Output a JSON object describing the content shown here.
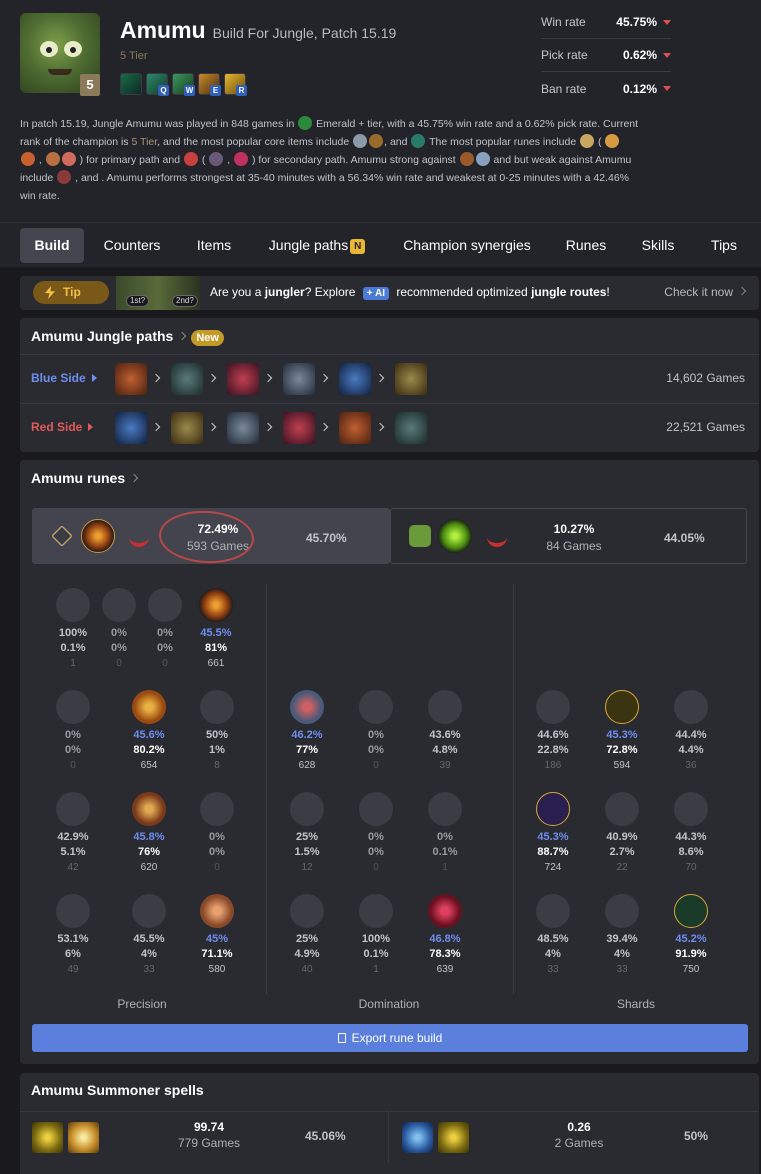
{
  "champion": {
    "name": "Amumu",
    "subtitle": "Build For Jungle, Patch 15.19",
    "tier_label": "5 Tier",
    "tier_badge": "5"
  },
  "skills": [
    {
      "key": ""
    },
    {
      "key": "Q"
    },
    {
      "key": "W"
    },
    {
      "key": "E"
    },
    {
      "key": "R"
    }
  ],
  "stats": [
    {
      "label": "Win rate",
      "value": "45.75%"
    },
    {
      "label": "Pick rate",
      "value": "0.62%"
    },
    {
      "label": "Ban rate",
      "value": "0.12%"
    }
  ],
  "description": {
    "l1a": "In patch 15.19, Jungle Amumu was played in 848 games in ",
    "l1b": " Emerald + tier, with a 45.75% win rate and a 0.62% pick rate. Current",
    "l2a": "rank of the champion is ",
    "l2tier": "5 Tier",
    "l2b": ", and the most popular core items include ",
    "l2c": ", and ",
    "l2d": " The most popular runes include ",
    "l2e": " ( ",
    "l3a": " , ",
    "l3b": " ) for primary path and ",
    "l3c": " ( ",
    "l3d": " , ",
    "l3e": " ) for secondary path. Amumu strong against ",
    "l3f": " and but weak against Amumu",
    "l4a": "include ",
    "l4b": " , and . Amumu performs strongest at 35-40 minutes with a 56.34% win rate and weakest at 0-25 minutes with a 42.46%",
    "l5": "win rate."
  },
  "tabs": [
    {
      "label": "Build"
    },
    {
      "label": "Counters"
    },
    {
      "label": "Items"
    },
    {
      "label": "Jungle paths",
      "badge": "N"
    },
    {
      "label": "Champion synergies"
    },
    {
      "label": "Runes"
    },
    {
      "label": "Skills"
    },
    {
      "label": "Tips"
    }
  ],
  "tip": {
    "badge": "Tip",
    "tag1": "1st?",
    "tag2": "2nd?",
    "t1": "Are you a ",
    "t2": "jungler",
    "t3": "? Explore ",
    "ai": "+ AI",
    "t4": " recommended optimized ",
    "t5": "jungle routes",
    "t6": "!",
    "cta": "Check it now"
  },
  "jungle_paths": {
    "title": "Amumu Jungle paths",
    "badge": "New",
    "rows": [
      {
        "label": "Blue Side",
        "games": "14,602 Games",
        "color": "#6f8ff0"
      },
      {
        "label": "Red Side",
        "games": "22,521 Games",
        "color": "#e05a5a"
      }
    ]
  },
  "runes": {
    "title": "Amumu runes",
    "pages": [
      {
        "pick": "72.49%",
        "games": "593 Games",
        "wr": "45.70%"
      },
      {
        "pick": "10.27%",
        "games": "84 Games",
        "wr": "44.05%"
      }
    ],
    "precision": [
      [
        {
          "a": "100%",
          "b": "0.1%",
          "c": "1"
        },
        {
          "a": "0%",
          "b": "0%",
          "c": "0"
        },
        {
          "a": "0%",
          "b": "0%",
          "c": "0"
        },
        {
          "a": "45.5%",
          "b": "81%",
          "c": "661",
          "on": true
        }
      ],
      [
        {
          "a": "0%",
          "b": "0%",
          "c": "0"
        },
        {
          "a": "45.6%",
          "b": "80.2%",
          "c": "654",
          "on": true
        },
        {
          "a": "50%",
          "b": "1%",
          "c": "8"
        }
      ],
      [
        {
          "a": "42.9%",
          "b": "5.1%",
          "c": "42"
        },
        {
          "a": "45.8%",
          "b": "76%",
          "c": "620",
          "on": true
        },
        {
          "a": "0%",
          "b": "0%",
          "c": "0"
        }
      ],
      [
        {
          "a": "53.1%",
          "b": "6%",
          "c": "49"
        },
        {
          "a": "45.5%",
          "b": "4%",
          "c": "33"
        },
        {
          "a": "45%",
          "b": "71.1%",
          "c": "580",
          "on": true
        }
      ]
    ],
    "domination": [
      [
        {
          "a": "46.2%",
          "b": "77%",
          "c": "628",
          "on": true
        },
        {
          "a": "0%",
          "b": "0%",
          "c": "0"
        },
        {
          "a": "43.6%",
          "b": "4.8%",
          "c": "39"
        }
      ],
      [
        {
          "a": "25%",
          "b": "1.5%",
          "c": "12"
        },
        {
          "a": "0%",
          "b": "0%",
          "c": "0"
        },
        {
          "a": "0%",
          "b": "0.1%",
          "c": "1"
        }
      ],
      [
        {
          "a": "25%",
          "b": "4.9%",
          "c": "40"
        },
        {
          "a": "100%",
          "b": "0.1%",
          "c": "1"
        },
        {
          "a": "46.8%",
          "b": "78.3%",
          "c": "639",
          "on": true
        }
      ]
    ],
    "shards": [
      [
        {
          "a": "44.6%",
          "b": "22.8%",
          "c": "186"
        },
        {
          "a": "45.3%",
          "b": "72.8%",
          "c": "594",
          "on": true
        },
        {
          "a": "44.4%",
          "b": "4.4%",
          "c": "36"
        }
      ],
      [
        {
          "a": "45.3%",
          "b": "88.7%",
          "c": "724",
          "on": true
        },
        {
          "a": "40.9%",
          "b": "2.7%",
          "c": "22"
        },
        {
          "a": "44.3%",
          "b": "8.6%",
          "c": "70"
        }
      ],
      [
        {
          "a": "48.5%",
          "b": "4%",
          "c": "33"
        },
        {
          "a": "39.4%",
          "b": "4%",
          "c": "33"
        },
        {
          "a": "45.2%",
          "b": "91.9%",
          "c": "750",
          "on": true
        }
      ]
    ],
    "tree_labels": [
      "Precision",
      "Domination",
      "Shards"
    ],
    "export": "Export rune build"
  },
  "spells": {
    "title": "Amumu Summoner spells",
    "options": [
      {
        "pick": "99.74",
        "games": "779 Games",
        "wr": "45.06%"
      },
      {
        "pick": "0.26",
        "games": "2 Games",
        "wr": "50%"
      }
    ]
  }
}
